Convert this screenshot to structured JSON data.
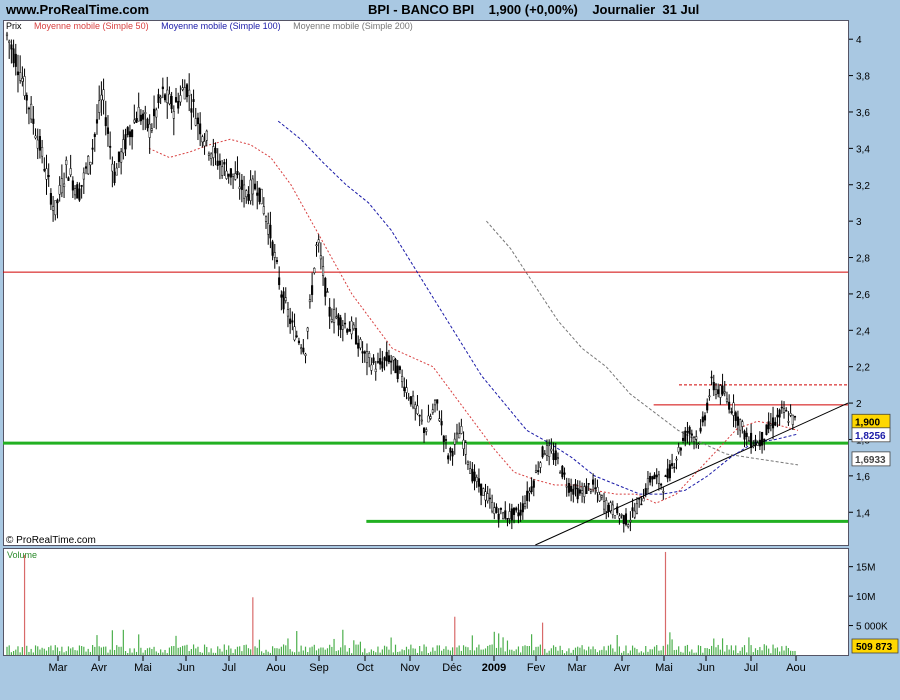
{
  "header": {
    "site": "www.ProRealTime.com",
    "title": "BPI - BANCO BPI    1,900 (+0,00%)    Journalier  31 Jul"
  },
  "legend": {
    "price": "Prix",
    "ma50": "Moyenne mobile (Simple 50)",
    "ma100": "Moyenne mobile (Simple 100)",
    "ma200": "Moyenne mobile (Simple 200)"
  },
  "copyright": "© ProRealTime.com",
  "volume_label": "Volume",
  "colors": {
    "price": "#000000",
    "ma50": "#d84040",
    "ma100": "#1b1ba8",
    "ma200": "#777777",
    "resistance": "#d00000",
    "support": "#22b022",
    "volume": "#4caf4c",
    "volume_spike": "#d86a6a",
    "price_badge": "#ffd700"
  },
  "chart_data": [
    {
      "type": "line",
      "title": "BPI - BANCO BPI",
      "ylim": [
        1.22,
        4.1
      ],
      "yticks": [
        "4",
        "3,8",
        "3,6",
        "3,4",
        "3,2",
        "3",
        "2,8",
        "2,6",
        "2,4",
        "2,2",
        "2",
        "1,8",
        "1,6",
        "1,4"
      ],
      "xticks": [
        "Mar",
        "Avr",
        "Mai",
        "Jun",
        "Jul",
        "Aou",
        "Sep",
        "Oct",
        "Nov",
        "Déc",
        "2009",
        "Fev",
        "Mar",
        "Avr",
        "Mai",
        "Jun",
        "Jul",
        "Aou"
      ],
      "price_path": [
        4.02,
        3.85,
        3.6,
        3.35,
        3.05,
        3.3,
        3.15,
        3.35,
        3.7,
        3.25,
        3.45,
        3.6,
        3.5,
        3.7,
        3.62,
        3.75,
        3.55,
        3.4,
        3.3,
        3.25,
        3.15,
        3.2,
        2.95,
        2.6,
        2.4,
        2.3,
        2.9,
        2.5,
        2.45,
        2.4,
        2.25,
        2.2,
        2.25,
        2.15,
        2.0,
        1.85,
        2.0,
        1.7,
        1.85,
        1.6,
        1.5,
        1.4,
        1.38,
        1.4,
        1.55,
        1.75,
        1.7,
        1.55,
        1.5,
        1.55,
        1.45,
        1.4,
        1.35,
        1.45,
        1.6,
        1.55,
        1.7,
        1.85,
        1.8,
        2.1,
        2.05,
        1.95,
        1.8,
        1.78,
        1.88,
        1.95,
        1.9
      ],
      "ma50_path": [
        null,
        null,
        null,
        null,
        null,
        null,
        null,
        3.4,
        3.35,
        3.38,
        3.42,
        3.45,
        3.42,
        3.35,
        3.2,
        3.0,
        2.8,
        2.6,
        2.45,
        2.3,
        2.25,
        2.2,
        2.05,
        1.9,
        1.75,
        1.62,
        1.58,
        1.55,
        1.55,
        1.52,
        1.5,
        1.5,
        1.45,
        1.5,
        1.62,
        1.74,
        1.86,
        1.9,
        1.88,
        1.85
      ],
      "ma100_path": [
        null,
        null,
        null,
        null,
        null,
        null,
        null,
        null,
        null,
        null,
        null,
        null,
        3.55,
        3.45,
        3.32,
        3.2,
        3.1,
        2.95,
        2.75,
        2.55,
        2.35,
        2.15,
        2.0,
        1.85,
        1.78,
        1.7,
        1.6,
        1.55,
        1.5,
        1.5,
        1.52,
        1.6,
        1.7,
        1.78,
        1.8,
        1.83
      ],
      "ma200_path": [
        null,
        null,
        null,
        null,
        null,
        null,
        null,
        null,
        null,
        null,
        null,
        null,
        null,
        null,
        null,
        null,
        null,
        null,
        null,
        null,
        3.0,
        2.85,
        2.65,
        2.45,
        2.3,
        2.2,
        2.05,
        1.95,
        1.85,
        1.78,
        1.72,
        1.7,
        1.68,
        1.66
      ],
      "horizontal_lines": [
        {
          "y": 2.72,
          "color": "resistance",
          "style": "solid"
        },
        {
          "y": 1.78,
          "color": "support",
          "style": "solid",
          "thick": true
        },
        {
          "y": 1.35,
          "color": "support",
          "style": "solid",
          "thick": true,
          "from": 0.43
        },
        {
          "y": 1.99,
          "color": "resistance",
          "style": "solid",
          "from": 0.77
        },
        {
          "y": 2.1,
          "color": "resistance",
          "style": "dashed",
          "from": 0.8
        }
      ],
      "trendline": {
        "from": [
          0.63,
          1.22
        ],
        "to": [
          1.0,
          2.0
        ]
      },
      "badges": [
        {
          "label": "1,900",
          "value": 1.9,
          "bg": "#ffd700",
          "fg": "#000000"
        },
        {
          "label": "1,8256",
          "value": 1.8256,
          "bg": "#ffffff",
          "fg": "#1b1ba8"
        },
        {
          "label": "1,6933",
          "value": 1.6933,
          "bg": "#ffffff",
          "fg": "#444444"
        }
      ]
    },
    {
      "type": "bar",
      "title": "Volume",
      "ylim": [
        0,
        18000000
      ],
      "yticks": [
        "15M",
        "10M",
        "5 000K"
      ],
      "last_value_label": "509 873"
    }
  ]
}
